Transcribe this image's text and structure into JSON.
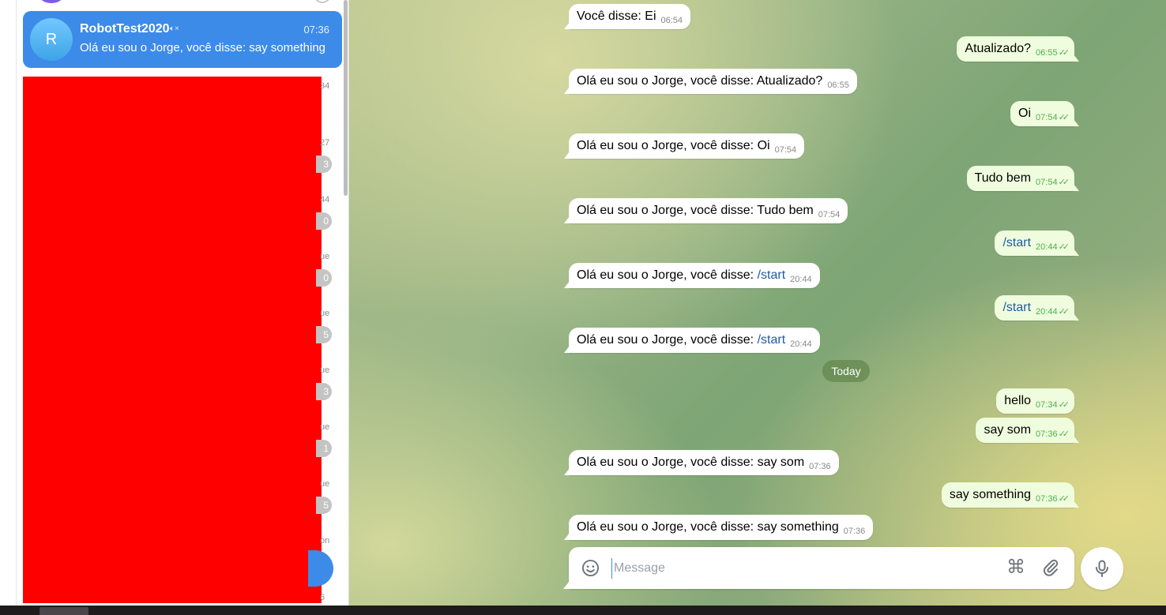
{
  "sidebar": {
    "active_chat": {
      "avatar_letter": "R",
      "name": "RobotTest2020",
      "mute_icon": "muted-speaker-icon",
      "time": "07:36",
      "preview": "Olá eu sou o Jorge, você disse: say something"
    },
    "partial_meta": [
      "34",
      "27",
      "44",
      "ue",
      "ue",
      "ue",
      "ue",
      "ue",
      "on",
      "6"
    ],
    "partial_badges": [
      "3",
      "0",
      "0",
      "5",
      "3",
      "1",
      "5"
    ]
  },
  "messages": [
    {
      "dir": "in",
      "text": "Você disse: Ei",
      "time": "06:54"
    },
    {
      "dir": "out",
      "text": "Atualizado?",
      "time": "06:55"
    },
    {
      "dir": "in",
      "text": "Olá eu sou o Jorge, você disse: Atualizado?",
      "time": "06:55"
    },
    {
      "dir": "out",
      "text": "Oi",
      "time": "07:54"
    },
    {
      "dir": "in",
      "text": "Olá eu sou o Jorge, você disse: Oi",
      "time": "07:54"
    },
    {
      "dir": "out",
      "text": "Tudo bem",
      "time": "07:54"
    },
    {
      "dir": "in",
      "text": "Olá eu sou o Jorge, você disse: Tudo bem",
      "time": "07:54"
    },
    {
      "dir": "out",
      "text": "/start",
      "time": "20:44"
    },
    {
      "dir": "in",
      "prefix": "Olá eu sou o Jorge, você disse: ",
      "command": "/start",
      "time": "20:44"
    },
    {
      "dir": "out",
      "text": "/start",
      "time": "20:44"
    },
    {
      "dir": "in",
      "prefix": "Olá eu sou o Jorge, você disse: ",
      "command": "/start",
      "time": "20:44"
    },
    {
      "dir": "out",
      "text": "hello",
      "time": "07:34"
    },
    {
      "dir": "out",
      "text": "say som",
      "time": "07:36"
    },
    {
      "dir": "in",
      "text": "Olá eu sou o Jorge, você disse: say som",
      "time": "07:36"
    },
    {
      "dir": "out",
      "text": "say something",
      "time": "07:36"
    },
    {
      "dir": "in",
      "text": "Olá eu sou o Jorge, você disse: say something",
      "time": "07:36"
    }
  ],
  "date_divider": "Today",
  "composer": {
    "placeholder": "Message",
    "icons": [
      "emoji-icon",
      "command-icon",
      "attach-icon",
      "microphone-icon"
    ]
  },
  "colors": {
    "accent": "#3d8be8",
    "outgoing_bubble": "#effdde",
    "incoming_bubble": "#ffffff",
    "read_check": "#4fae4e",
    "redaction": "#ff0000"
  }
}
